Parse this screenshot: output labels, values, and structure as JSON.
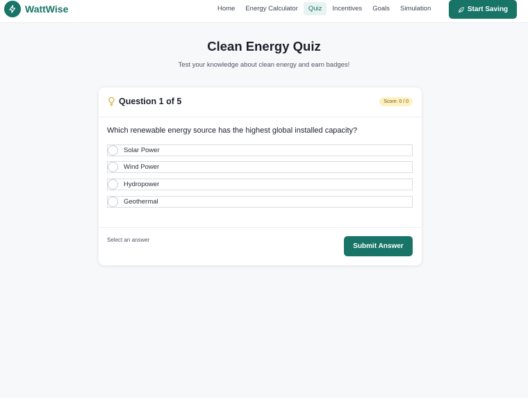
{
  "nav": {
    "brand": "WattWise",
    "links": [
      {
        "label": "Home",
        "active": false
      },
      {
        "label": "Energy Calculator",
        "active": false
      },
      {
        "label": "Quiz",
        "active": true
      },
      {
        "label": "Incentives",
        "active": false
      },
      {
        "label": "Goals",
        "active": false
      },
      {
        "label": "Simulation",
        "active": false
      }
    ],
    "cta_label": "Start Saving"
  },
  "page": {
    "title": "Clean Energy Quiz",
    "subtitle": "Test your knowledge about clean energy and earn badges!"
  },
  "quiz": {
    "question_number": "Question 1 of 5",
    "score_label": "Score: 0 / 0",
    "question": "Which renewable energy source has the highest global installed capacity?",
    "options": [
      "Solar Power",
      "Wind Power",
      "Hydropower",
      "Geothermal"
    ],
    "hint": "Select an answer",
    "submit_label": "Submit Answer"
  },
  "colors": {
    "accent": "#177466",
    "badge_bg": "#fdf1c4",
    "bulb": "#e0a52a"
  },
  "icons": {
    "logo": "lightning-icon",
    "cta": "leaf-icon",
    "question": "lightbulb-icon"
  }
}
